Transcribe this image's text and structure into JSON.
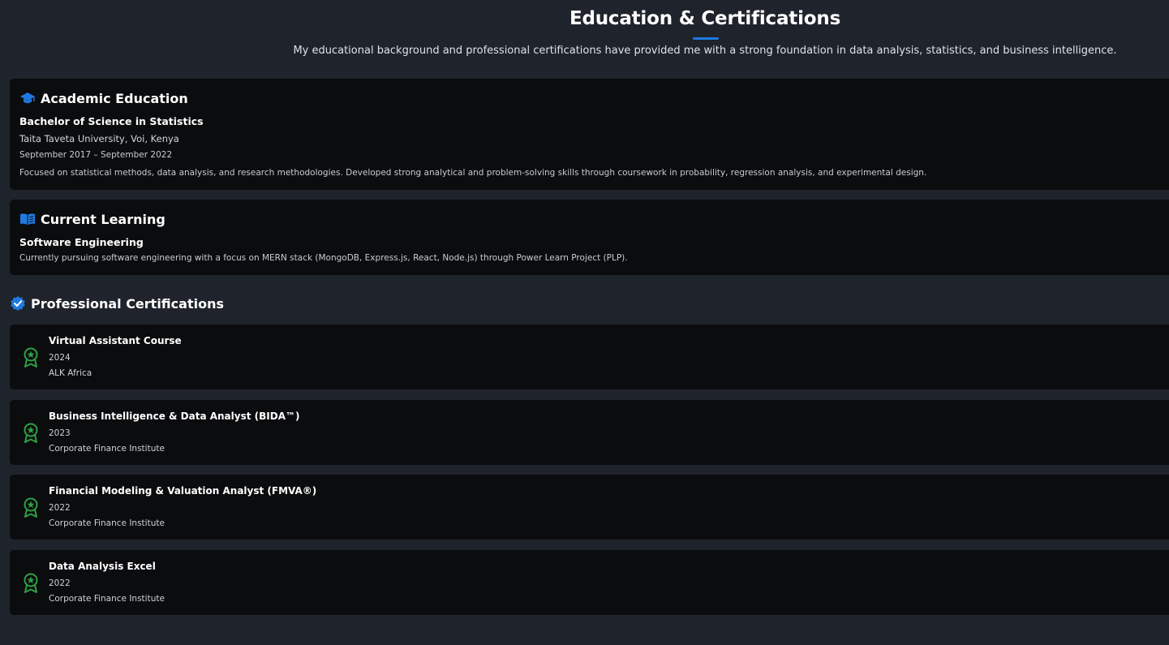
{
  "header": {
    "title": "Education & Certifications",
    "subtitle": "My educational background and professional certifications have provided me with a strong foundation in data analysis, statistics, and business intelligence."
  },
  "academic": {
    "heading": "Academic Education",
    "icon": "graduation-cap-icon",
    "degree": "Bachelor of Science in Statistics",
    "school": "Taita Taveta University, Voi, Kenya",
    "dates": "September 2017 – September 2022",
    "description": "Focused on statistical methods, data analysis, and research methodologies. Developed strong analytical and problem-solving skills through coursework in probability, regression analysis, and experimental design."
  },
  "current": {
    "heading": "Current Learning",
    "icon": "book-open-icon",
    "program": "Software Engineering",
    "description": "Currently pursuing software engineering with a focus on MERN stack (MongoDB, Express.js, React, Node.js) through Power Learn Project (PLP)."
  },
  "certifications": {
    "heading": "Professional Certifications",
    "icon": "verified-badge-icon",
    "items": [
      {
        "name": "Virtual Assistant Course",
        "year": "2024",
        "org": "ALK Africa"
      },
      {
        "name": "Business Intelligence & Data Analyst (BIDA™)",
        "year": "2023",
        "org": "Corporate Finance Institute"
      },
      {
        "name": "Financial Modeling & Valuation Analyst (FMVA®)",
        "year": "2022",
        "org": "Corporate Finance Institute"
      },
      {
        "name": "Data Analysis Excel",
        "year": "2022",
        "org": "Corporate Finance Institute"
      }
    ]
  },
  "colors": {
    "background": "#1f232b",
    "card": "#0b0c0e",
    "accent_blue": "#1f7ae0",
    "badge_green": "#2ea043"
  }
}
